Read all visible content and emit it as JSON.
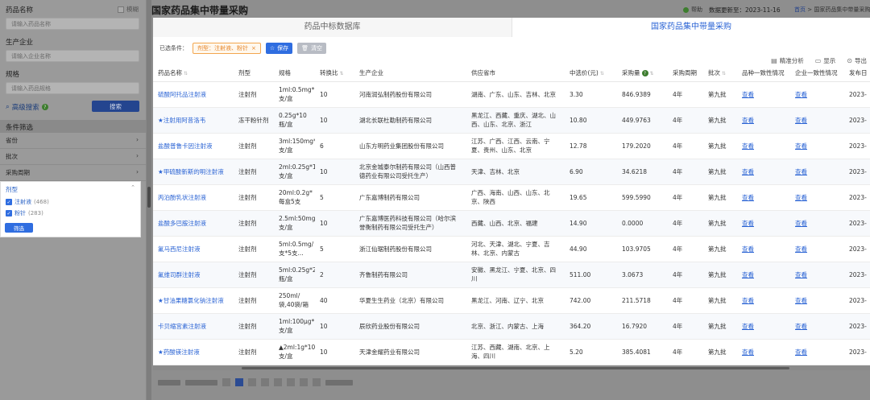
{
  "sidebar": {
    "drug_name_label": "药品名称",
    "drug_name_placeholder": "请输入药品名称",
    "fuzzy_label": "模糊",
    "company_label": "生产企业",
    "company_placeholder": "请输入企业名称",
    "spec_label": "规格",
    "spec_placeholder": "请输入药品规格",
    "advanced_search": "高级搜索",
    "search_button": "搜索",
    "condition_filter": "条件筛选",
    "filters": [
      {
        "label": "省份"
      },
      {
        "label": "批次"
      },
      {
        "label": "采购周期"
      }
    ],
    "dosage_panel": {
      "title": "剂型",
      "options": [
        {
          "label": "注射液",
          "count": "(468)",
          "checked": true
        },
        {
          "label": "粉针",
          "count": "(283)",
          "checked": true
        }
      ],
      "filter_button": "筛选"
    }
  },
  "header": {
    "title": "国家药品集中带量采购",
    "help": "帮助",
    "update_label": "数据更新至：2023-11-16",
    "breadcrumb_home": "首页",
    "breadcrumb_rest": " > 国家药品集中带量采购"
  },
  "modal": {
    "tabs": [
      {
        "label": "药品中标数据库",
        "active": false
      },
      {
        "label": "国家药品集中带量采购",
        "active": true
      }
    ],
    "selected_label": "已选条件：",
    "selected_tag": "剂型：注射液、粉针",
    "save_button": "保存",
    "clear_button": "清空",
    "tools": {
      "analysis": "精准分析",
      "display": "显示",
      "export": "导出"
    },
    "table": {
      "headers": [
        "药品名称",
        "剂型",
        "规格",
        "转换比",
        "生产企业",
        "供应省市",
        "中选价(元)",
        "采购量",
        "采购周期",
        "批次",
        "品种一致性情况",
        "企业一致性情况",
        "发布日"
      ],
      "rows": [
        {
          "name": "硫酸阿托品注射液",
          "form": "注射剂",
          "spec": "1ml:0.5mg*10支/盒",
          "ratio": "10",
          "company": "河南润弘制药股份有限公司",
          "provinces": "湖南、广东、山东、吉林、北京",
          "price": "3.30",
          "volume": "846.9389",
          "cycle": "4年",
          "batch": "第九批",
          "variety": "查看",
          "enterprise": "查看",
          "date": "2023-"
        },
        {
          "name": "★注射用阿昔洛韦",
          "form": "冻干粉针剂",
          "spec": "0.25g*10瓶/盒",
          "ratio": "10",
          "company": "湖北长联杜勒制药有限公司",
          "provinces": "黑龙江、西藏、重庆、湖北、山西、山东、北京、浙江",
          "price": "10.80",
          "volume": "449.9763",
          "cycle": "4年",
          "batch": "第九批",
          "variety": "查看",
          "enterprise": "查看",
          "date": "2023-"
        },
        {
          "name": "盐酸普鲁卡因注射液",
          "form": "注射剂",
          "spec": "3ml:150mg*6支/盒",
          "ratio": "6",
          "company": "山东方明药业集团股份有限公司",
          "provinces": "江苏、广西、江西、云南、宁夏、贵州、山东、北京",
          "price": "12.78",
          "volume": "179.2020",
          "cycle": "4年",
          "batch": "第九批",
          "variety": "查看",
          "enterprise": "查看",
          "date": "2023-"
        },
        {
          "name": "★甲硫酸新斯的明注射液",
          "form": "注射剂",
          "spec": "2ml:0.25g*10支/盒",
          "ratio": "10",
          "company": "北京金城泰尔制药有限公司（山西普德药业有限公司受托生产）",
          "provinces": "天津、吉林、北京",
          "price": "6.90",
          "volume": "34.6218",
          "cycle": "4年",
          "batch": "第九批",
          "variety": "查看",
          "enterprise": "查看",
          "date": "2023-"
        },
        {
          "name": "丙泊酚乳状注射液",
          "form": "注射剂",
          "spec": "20ml:0.2g*每盒5支",
          "ratio": "5",
          "company": "广东嘉博制药有限公司",
          "provinces": "广西、海南、山西、山东、北京、陕西",
          "price": "19.65",
          "volume": "599.5990",
          "cycle": "4年",
          "batch": "第九批",
          "variety": "查看",
          "enterprise": "查看",
          "date": "2023-"
        },
        {
          "name": "盐酸多巴胺注射液",
          "form": "注射剂",
          "spec": "2.5ml:50mg*10支/盒",
          "ratio": "10",
          "company": "广东嘉博医药科技有限公司（哈尔滨誉衡制药有限公司受托生产）",
          "provinces": "西藏、山西、北京、福建",
          "price": "14.90",
          "volume": "0.0000",
          "cycle": "4年",
          "batch": "第九批",
          "variety": "查看",
          "enterprise": "查看",
          "date": "2023-"
        },
        {
          "name": "氟马西尼注射液",
          "form": "注射剂",
          "spec": "5ml:0.5mg/支*5支...",
          "ratio": "5",
          "company": "浙江仙琚制药股份有限公司",
          "provinces": "河北、天津、湖北、宁夏、吉林、北京、内蒙古",
          "price": "44.90",
          "volume": "103.9705",
          "cycle": "4年",
          "batch": "第九批",
          "variety": "查看",
          "enterprise": "查看",
          "date": "2023-"
        },
        {
          "name": "氟维司群注射液",
          "form": "注射剂",
          "spec": "5ml:0.25g*2瓶/盒",
          "ratio": "2",
          "company": "齐鲁制药有限公司",
          "provinces": "安徽、黑龙江、宁夏、北京、四川",
          "price": "511.00",
          "volume": "3.0673",
          "cycle": "4年",
          "batch": "第九批",
          "variety": "查看",
          "enterprise": "查看",
          "date": "2023-"
        },
        {
          "name": "★甘油果糖氯化钠注射液",
          "form": "注射剂",
          "spec": "250ml/袋,40袋/箱",
          "ratio": "40",
          "company": "华夏生生药业（北京）有限公司",
          "provinces": "黑龙江、河南、辽宁、北京",
          "price": "742.00",
          "volume": "211.5718",
          "cycle": "4年",
          "batch": "第九批",
          "variety": "查看",
          "enterprise": "查看",
          "date": "2023-"
        },
        {
          "name": "卡贝缩宫素注射液",
          "form": "注射剂",
          "spec": "1ml:100μg*10支/盒",
          "ratio": "10",
          "company": "辰欣药业股份有限公司",
          "provinces": "北京、浙江、内蒙古、上海",
          "price": "364.20",
          "volume": "16.7920",
          "cycle": "4年",
          "batch": "第九批",
          "variety": "查看",
          "enterprise": "查看",
          "date": "2023-"
        },
        {
          "name": "★药酸镁注射液",
          "form": "注射剂",
          "spec": "▲2ml:1g*10支/盒",
          "ratio": "10",
          "company": "天津金耀药业有限公司",
          "provinces": "江苏、西藏、湖南、北京、上海、四川",
          "price": "5.20",
          "volume": "385.4081",
          "cycle": "4年",
          "batch": "第九批",
          "variety": "查看",
          "enterprise": "查看",
          "date": "2023-"
        }
      ]
    }
  }
}
